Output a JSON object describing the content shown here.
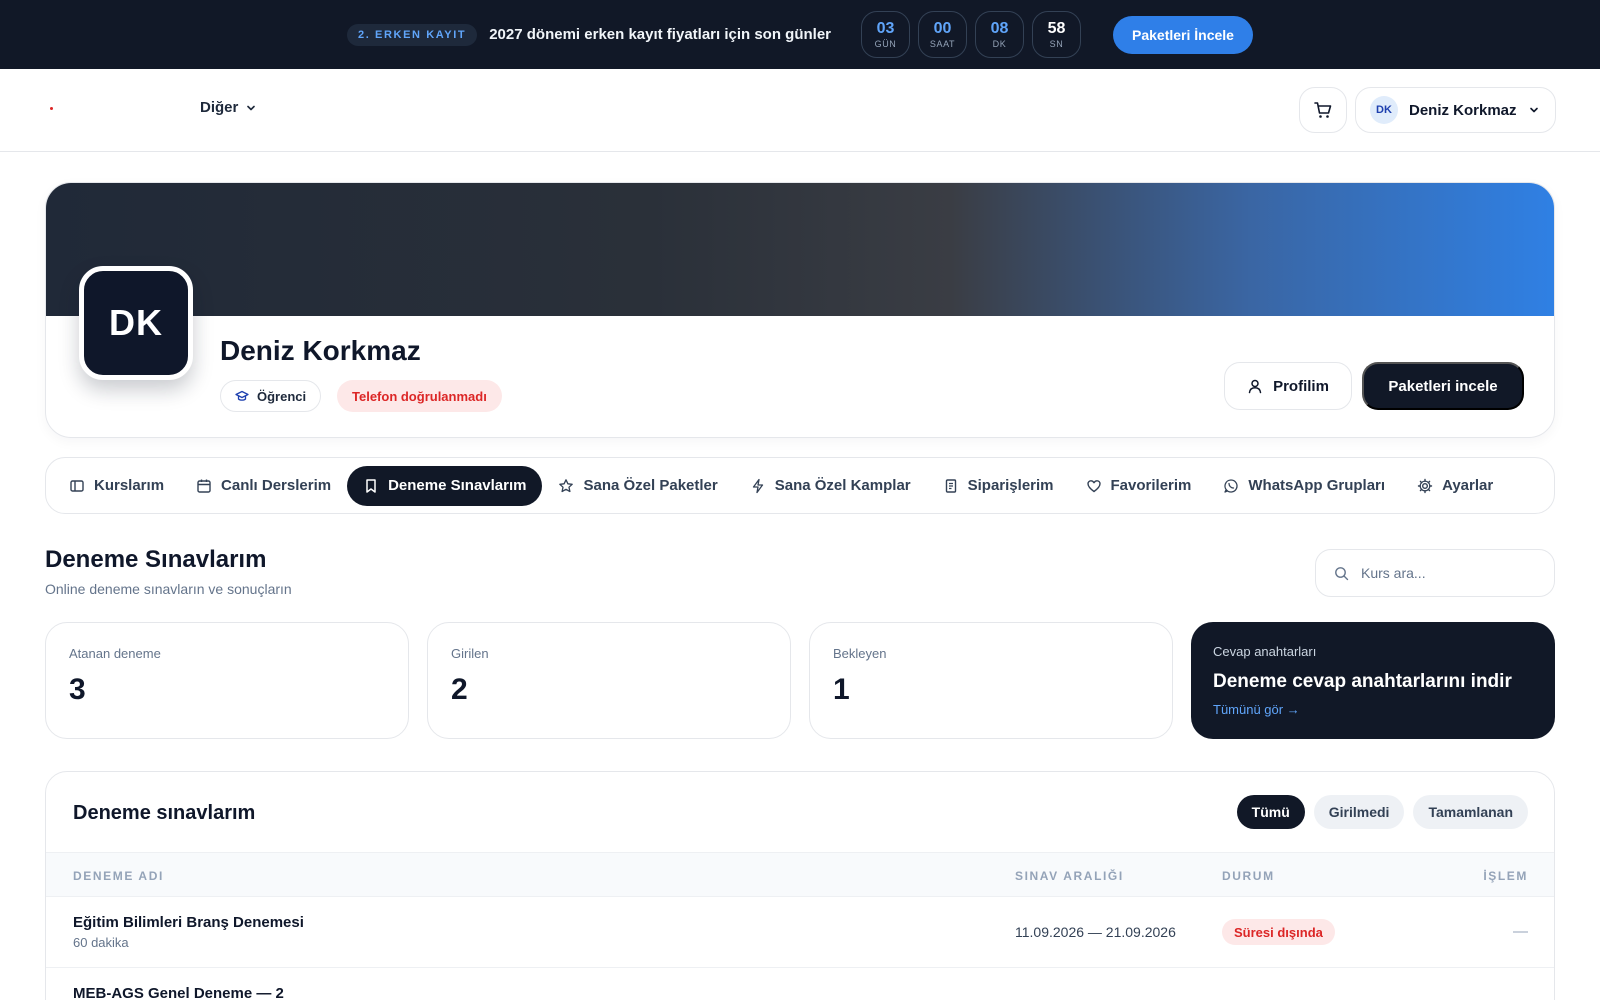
{
  "banner": {
    "badge": "2. ERKEN KAYIT",
    "text": "2027 dönemi erken kayıt fiyatları için son günler",
    "countdown": [
      {
        "value": "03",
        "label": "GÜN"
      },
      {
        "value": "00",
        "label": "SAAT"
      },
      {
        "value": "08",
        "label": "DK"
      },
      {
        "value": "58",
        "label": "SN"
      }
    ],
    "cta": "Paketleri İncele"
  },
  "header": {
    "nav_more": "Diğer",
    "user_initials": "DK",
    "user_name": "Deniz Korkmaz"
  },
  "profile": {
    "initials": "DK",
    "name": "Deniz Korkmaz",
    "role": "Öğrenci",
    "phone_status": "Telefon doğrulanmadı",
    "profile_btn": "Profilim",
    "packages_btn": "Paketleri incele"
  },
  "tabs": [
    {
      "label": "Kurslarım",
      "icon": "book-icon"
    },
    {
      "label": "Canlı Derslerim",
      "icon": "calendar-icon"
    },
    {
      "label": "Deneme Sınavlarım",
      "icon": "bookmark-icon"
    },
    {
      "label": "Sana Özel Paketler",
      "icon": "star-icon"
    },
    {
      "label": "Sana Özel Kamplar",
      "icon": "lightning-icon"
    },
    {
      "label": "Siparişlerim",
      "icon": "receipt-icon"
    },
    {
      "label": "Favorilerim",
      "icon": "heart-icon"
    },
    {
      "label": "WhatsApp Grupları",
      "icon": "whatsapp-icon"
    },
    {
      "label": "Ayarlar",
      "icon": "gear-icon"
    }
  ],
  "section": {
    "title": "Deneme Sınavlarım",
    "subtitle": "Online deneme sınavların ve sonuçların",
    "search_placeholder": "Kurs ara..."
  },
  "stats": [
    {
      "label": "Atanan deneme",
      "value": "3"
    },
    {
      "label": "Girilen",
      "value": "2"
    },
    {
      "label": "Bekleyen",
      "value": "1"
    }
  ],
  "answer_keys": {
    "label": "Cevap anahtarları",
    "title": "Deneme cevap anahtarlarını indir",
    "link": "Tümünü gör →"
  },
  "table": {
    "title": "Deneme sınavlarım",
    "filters": [
      "Tümü",
      "Girilmedi",
      "Tamamlanan"
    ],
    "columns": [
      "DENEME ADI",
      "SINAV ARALIĞI",
      "DURUM",
      "İŞLEM"
    ],
    "rows": [
      {
        "name": "Eğitim Bilimleri Branş Denemesi",
        "duration": "60 dakika",
        "range": "11.09.2026 — 21.09.2026",
        "status": "Süresi dışında",
        "action": "—"
      },
      {
        "name": "MEB-AGS Genel Deneme — 2",
        "duration": "",
        "range": "",
        "status": "",
        "action": ""
      }
    ]
  },
  "colors": {
    "dark": "#111827",
    "accent": "#2f7fe8",
    "danger": "#dc2626"
  }
}
